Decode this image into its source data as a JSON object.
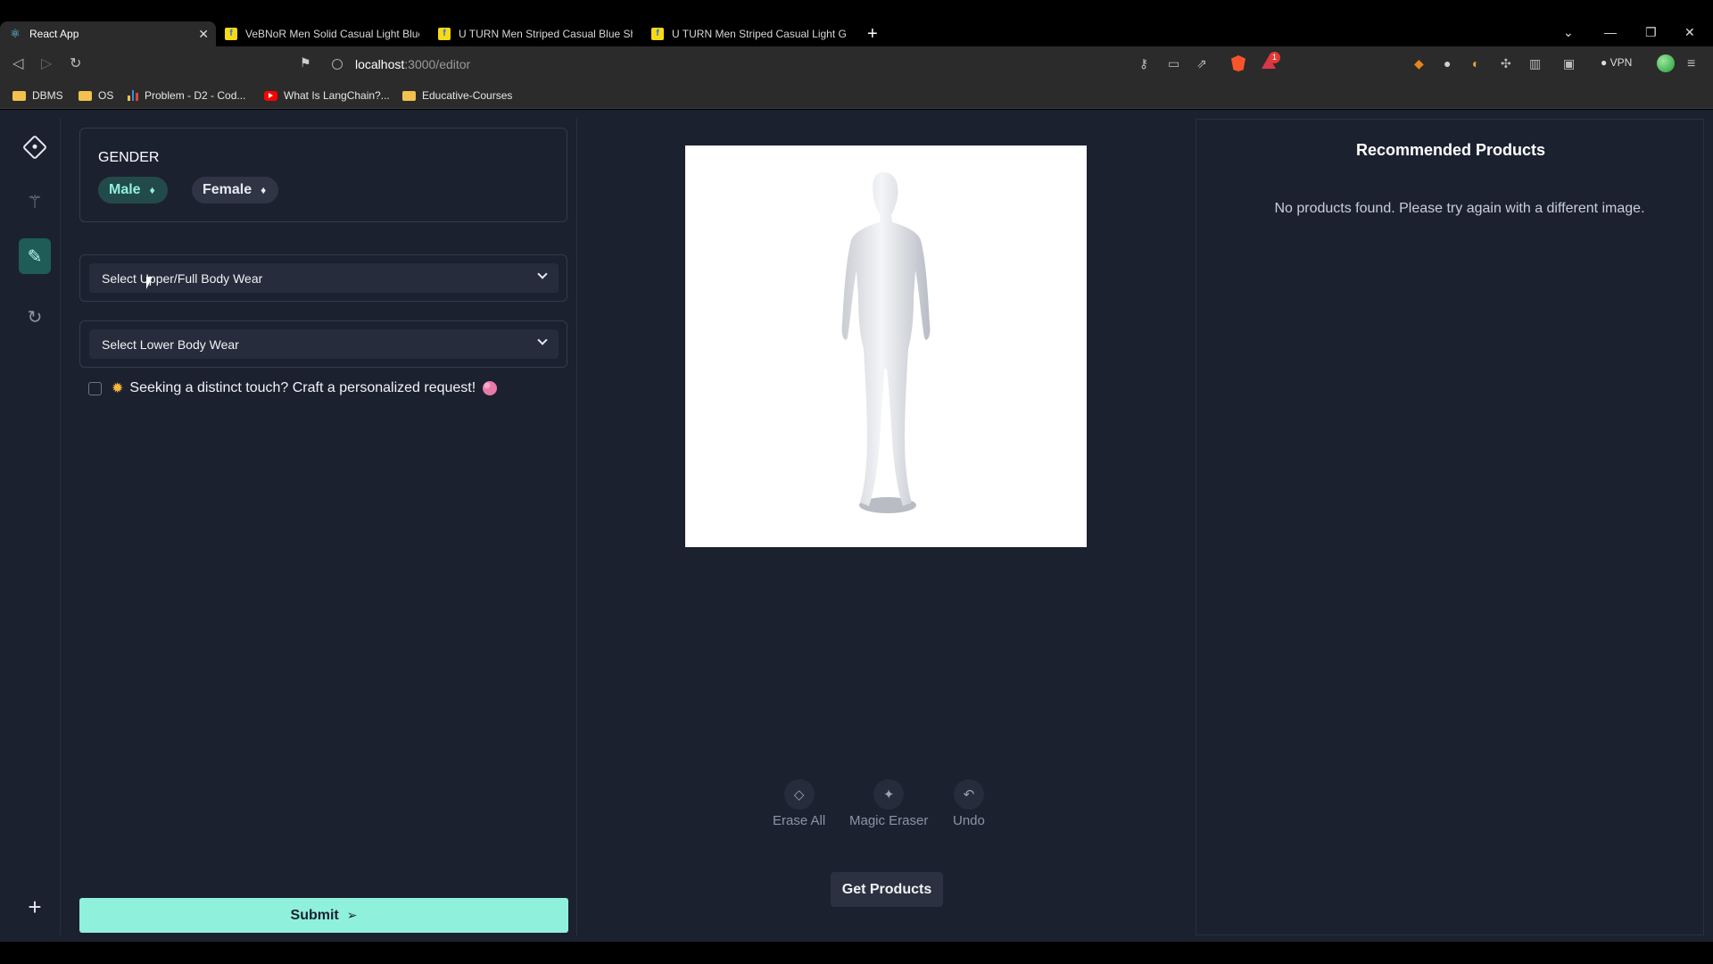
{
  "browser": {
    "tabs": [
      {
        "title": "React App",
        "icon": "react-icon",
        "active": true
      },
      {
        "title": "VeBNoR Men Solid Casual Light Blue S",
        "icon": "flipkart-icon"
      },
      {
        "title": "U TURN Men Striped Casual Blue Shirt",
        "icon": "flipkart-icon"
      },
      {
        "title": "U TURN Men Striped Casual Light Gre",
        "icon": "flipkart-icon"
      }
    ],
    "url_host": "localhost",
    "url_path": ":3000/editor",
    "vpn_label": "VPN",
    "alert_count": "1",
    "bookmarks": [
      "DBMS",
      "OS",
      "Problem - D2 - Cod...",
      "What Is LangChain?...",
      "Educative-Courses"
    ]
  },
  "sidebar": {
    "icons": [
      "logo-icon",
      "magic-wand-icon",
      "edit-icon",
      "history-icon",
      "add-icon"
    ]
  },
  "gender": {
    "title": "GENDER",
    "options": [
      {
        "label": "Male",
        "selected": true
      },
      {
        "label": "Female",
        "selected": false
      }
    ]
  },
  "selects": {
    "upper": "Select Upper/Full Body Wear",
    "lower": "Select Lower Body Wear"
  },
  "custom_request": {
    "label": "Seeking a distinct touch? Craft a personalized request!",
    "checked": false
  },
  "submit_label": "Submit",
  "tools": {
    "erase_all": "Erase All",
    "magic_eraser": "Magic Eraser",
    "undo": "Undo"
  },
  "get_products_label": "Get Products",
  "recommended": {
    "title": "Recommended Products",
    "empty_message": "No products found. Please try again with a different image."
  },
  "colors": {
    "app_bg": "#1c2130",
    "accent": "#8ff0dc",
    "selected_pill_bg": "#234a4a"
  }
}
